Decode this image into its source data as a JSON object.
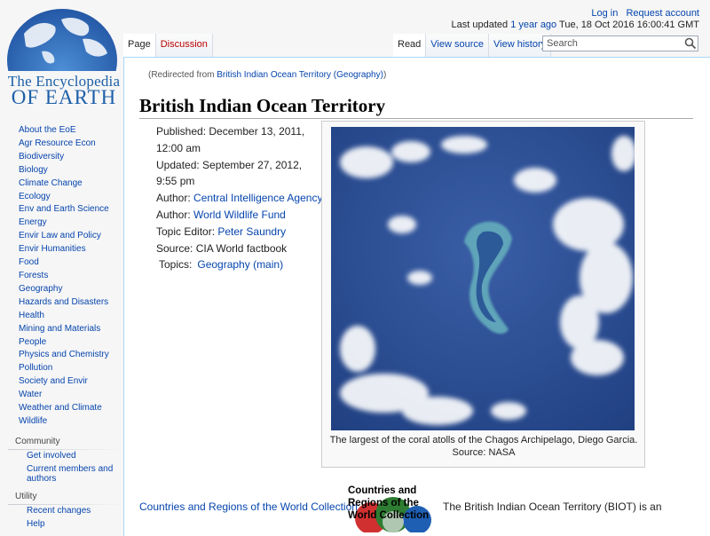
{
  "logo": {
    "line1": "The Encyclopedia",
    "line2": "OF EARTH"
  },
  "personal": {
    "login": "Log in",
    "request": "Request account",
    "last_updated_prefix": "Last updated ",
    "last_updated_link": "1 year ago",
    "last_updated_date": " Tue, 18 Oct 2016 16:00:41 GMT"
  },
  "tabs": {
    "page": "Page",
    "discussion": "Discussion",
    "read": "Read",
    "view_source": "View source",
    "view_history": "View history"
  },
  "search": {
    "placeholder": "Search"
  },
  "redirect": {
    "prefix": "(Redirected from ",
    "link": "British Indian Ocean Territory (Geography)",
    "suffix": ")"
  },
  "title": "British Indian Ocean Territory",
  "meta": {
    "published_label": "Published: December 13, 2011, 12:00 am",
    "updated_label": "Updated: September 27, 2012, 9:55 pm",
    "author_label": "Author: ",
    "author1": "Central Intelligence Agency",
    "author_label2": "Author: ",
    "author2": "World Wildlife Fund",
    "editor_label": "Topic Editor: ",
    "editor": "Peter Saundry",
    "source": "Source: CIA World factbook",
    "topics_label": "Topics:",
    "topics_link": "Geography (main)"
  },
  "thumb": {
    "caption": "The largest of the coral atolls of the Chagos Archipelago, Diego Garcia. Source: NASA"
  },
  "collection": {
    "link": "Countries and Regions of the World Collection",
    "badge": "Countries and Regions of the World Collection",
    "intro": "The British Indian Ocean Territory (BIOT) is an"
  },
  "sidebar": {
    "nav": [
      "About the EoE",
      "Agr Resource Econ",
      "Biodiversity",
      "Biology",
      "Climate Change",
      "Ecology",
      "Env and Earth Science",
      "Energy",
      "Envir Law and Policy",
      "Envir Humanities",
      "Food",
      "Forests",
      "Geography",
      "Hazards and Disasters",
      "Health",
      "Mining and Materials",
      "People",
      "Physics and Chemistry",
      "Pollution",
      "Society and Envir",
      "Water",
      "Weather and Climate",
      "Wildlife"
    ],
    "community_head": "Community",
    "community": [
      "Get involved",
      "Current members and authors"
    ],
    "utility_head": "Utility",
    "utility": [
      "Recent changes",
      "Help"
    ]
  },
  "colors": {
    "link": "#0645ad",
    "new_link": "#ba0000",
    "logo_blue": "#1d5fa8",
    "ocean": "#2e4f92"
  }
}
